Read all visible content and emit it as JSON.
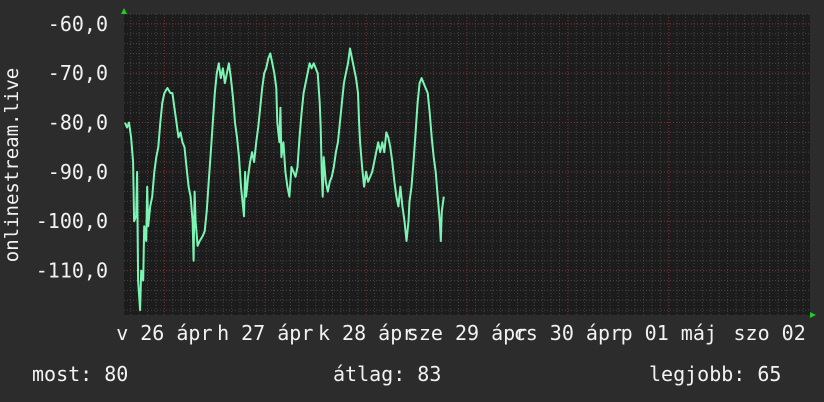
{
  "chart_data": {
    "type": "line",
    "ylabel": "onlinestream.live",
    "y_ticks": [
      "-60,0",
      "-70,0",
      "-80,0",
      "-90,0",
      "-100,0",
      "-110,0"
    ],
    "y_tick_values": [
      -60,
      -70,
      -80,
      -90,
      -100,
      -110
    ],
    "ylim": [
      -119,
      -58
    ],
    "x_ticks": [
      {
        "label": "v 26 ápr",
        "x": 1
      },
      {
        "label": "h 27 ápr",
        "x": 2
      },
      {
        "label": "k 28 ápr",
        "x": 3
      },
      {
        "label": "sze 29 ápr",
        "x": 4
      },
      {
        "label": "cs 30 ápr",
        "x": 5
      },
      {
        "label": "p 01 máj",
        "x": 6
      },
      {
        "label": "szo 02",
        "x": 7
      }
    ],
    "xlim": [
      0.6,
      7.4
    ],
    "grid": true,
    "colors": {
      "line": "#7cf5b4",
      "plot_bg": "#1c1c1c",
      "grid": "#555555",
      "axis_arrow": "#22cc22"
    },
    "series": [
      {
        "points": [
          [
            0.61,
            -80
          ],
          [
            0.63,
            -81
          ],
          [
            0.65,
            -80
          ],
          [
            0.67,
            -83
          ],
          [
            0.69,
            -88
          ],
          [
            0.7,
            -100
          ],
          [
            0.72,
            -99
          ],
          [
            0.73,
            -90
          ],
          [
            0.74,
            -112
          ],
          [
            0.76,
            -118
          ],
          [
            0.77,
            -110
          ],
          [
            0.79,
            -112
          ],
          [
            0.8,
            -101
          ],
          [
            0.82,
            -104
          ],
          [
            0.83,
            -93
          ],
          [
            0.84,
            -101
          ],
          [
            0.86,
            -97
          ],
          [
            0.88,
            -95
          ],
          [
            0.9,
            -90
          ],
          [
            0.92,
            -87
          ],
          [
            0.94,
            -85
          ],
          [
            0.96,
            -80
          ],
          [
            0.98,
            -76
          ],
          [
            1.0,
            -74
          ],
          [
            1.03,
            -73
          ],
          [
            1.06,
            -74
          ],
          [
            1.08,
            -74
          ],
          [
            1.1,
            -77
          ],
          [
            1.12,
            -80
          ],
          [
            1.14,
            -83
          ],
          [
            1.16,
            -82
          ],
          [
            1.18,
            -84
          ],
          [
            1.2,
            -85
          ],
          [
            1.22,
            -89
          ],
          [
            1.24,
            -93
          ],
          [
            1.26,
            -95
          ],
          [
            1.28,
            -100
          ],
          [
            1.29,
            -108
          ],
          [
            1.3,
            -94
          ],
          [
            1.31,
            -100
          ],
          [
            1.33,
            -105
          ],
          [
            1.35,
            -104
          ],
          [
            1.38,
            -103
          ],
          [
            1.4,
            -102
          ],
          [
            1.42,
            -98
          ],
          [
            1.44,
            -92
          ],
          [
            1.46,
            -86
          ],
          [
            1.48,
            -80
          ],
          [
            1.5,
            -74
          ],
          [
            1.52,
            -70
          ],
          [
            1.54,
            -68
          ],
          [
            1.56,
            -71
          ],
          [
            1.58,
            -69
          ],
          [
            1.6,
            -72
          ],
          [
            1.62,
            -70
          ],
          [
            1.64,
            -68
          ],
          [
            1.66,
            -71
          ],
          [
            1.68,
            -75
          ],
          [
            1.7,
            -80
          ],
          [
            1.72,
            -83
          ],
          [
            1.74,
            -87
          ],
          [
            1.76,
            -93
          ],
          [
            1.78,
            -97
          ],
          [
            1.79,
            -99
          ],
          [
            1.8,
            -90
          ],
          [
            1.81,
            -95
          ],
          [
            1.83,
            -91
          ],
          [
            1.85,
            -88
          ],
          [
            1.87,
            -86
          ],
          [
            1.89,
            -88
          ],
          [
            1.91,
            -84
          ],
          [
            1.93,
            -81
          ],
          [
            1.95,
            -77
          ],
          [
            1.97,
            -73
          ],
          [
            1.99,
            -70
          ],
          [
            2.01,
            -69
          ],
          [
            2.03,
            -67
          ],
          [
            2.05,
            -66
          ],
          [
            2.07,
            -68
          ],
          [
            2.09,
            -70
          ],
          [
            2.11,
            -73
          ],
          [
            2.12,
            -80
          ],
          [
            2.14,
            -84
          ],
          [
            2.15,
            -77
          ],
          [
            2.16,
            -87
          ],
          [
            2.18,
            -84
          ],
          [
            2.2,
            -90
          ],
          [
            2.22,
            -93
          ],
          [
            2.24,
            -95
          ],
          [
            2.26,
            -89
          ],
          [
            2.28,
            -90
          ],
          [
            2.3,
            -91
          ],
          [
            2.32,
            -89
          ],
          [
            2.34,
            -83
          ],
          [
            2.36,
            -78
          ],
          [
            2.38,
            -74
          ],
          [
            2.4,
            -72
          ],
          [
            2.42,
            -70
          ],
          [
            2.44,
            -68
          ],
          [
            2.46,
            -69
          ],
          [
            2.48,
            -68
          ],
          [
            2.5,
            -69
          ],
          [
            2.52,
            -70
          ],
          [
            2.54,
            -76
          ],
          [
            2.55,
            -81
          ],
          [
            2.56,
            -90
          ],
          [
            2.57,
            -95
          ],
          [
            2.58,
            -87
          ],
          [
            2.6,
            -92
          ],
          [
            2.62,
            -94
          ],
          [
            2.64,
            -92
          ],
          [
            2.66,
            -91
          ],
          [
            2.68,
            -89
          ],
          [
            2.7,
            -86
          ],
          [
            2.72,
            -84
          ],
          [
            2.74,
            -80
          ],
          [
            2.76,
            -76
          ],
          [
            2.78,
            -72
          ],
          [
            2.8,
            -70
          ],
          [
            2.82,
            -68
          ],
          [
            2.84,
            -65
          ],
          [
            2.86,
            -67
          ],
          [
            2.88,
            -69
          ],
          [
            2.9,
            -71
          ],
          [
            2.92,
            -74
          ],
          [
            2.93,
            -80
          ],
          [
            2.94,
            -84
          ],
          [
            2.96,
            -89
          ],
          [
            2.98,
            -93
          ],
          [
            3.0,
            -90
          ],
          [
            3.02,
            -92
          ],
          [
            3.04,
            -91
          ],
          [
            3.06,
            -90
          ],
          [
            3.08,
            -88
          ],
          [
            3.1,
            -86
          ],
          [
            3.12,
            -84
          ],
          [
            3.14,
            -86
          ],
          [
            3.16,
            -84
          ],
          [
            3.18,
            -86
          ],
          [
            3.2,
            -82
          ],
          [
            3.22,
            -83
          ],
          [
            3.24,
            -85
          ],
          [
            3.26,
            -88
          ],
          [
            3.28,
            -92
          ],
          [
            3.3,
            -95
          ],
          [
            3.32,
            -97
          ],
          [
            3.34,
            -93
          ],
          [
            3.36,
            -97
          ],
          [
            3.38,
            -100
          ],
          [
            3.4,
            -104
          ],
          [
            3.42,
            -100
          ],
          [
            3.43,
            -96
          ],
          [
            3.45,
            -93
          ],
          [
            3.47,
            -88
          ],
          [
            3.49,
            -82
          ],
          [
            3.51,
            -76
          ],
          [
            3.53,
            -72
          ],
          [
            3.55,
            -71
          ],
          [
            3.57,
            -72
          ],
          [
            3.59,
            -73
          ],
          [
            3.61,
            -74
          ],
          [
            3.63,
            -78
          ],
          [
            3.65,
            -83
          ],
          [
            3.67,
            -87
          ],
          [
            3.69,
            -90
          ],
          [
            3.71,
            -95
          ],
          [
            3.73,
            -100
          ],
          [
            3.74,
            -104
          ],
          [
            3.75,
            -98
          ],
          [
            3.77,
            -95
          ]
        ]
      }
    ]
  },
  "footer": {
    "now": "most: 80",
    "avg": "átlag: 83",
    "best": "legjobb: 65"
  }
}
